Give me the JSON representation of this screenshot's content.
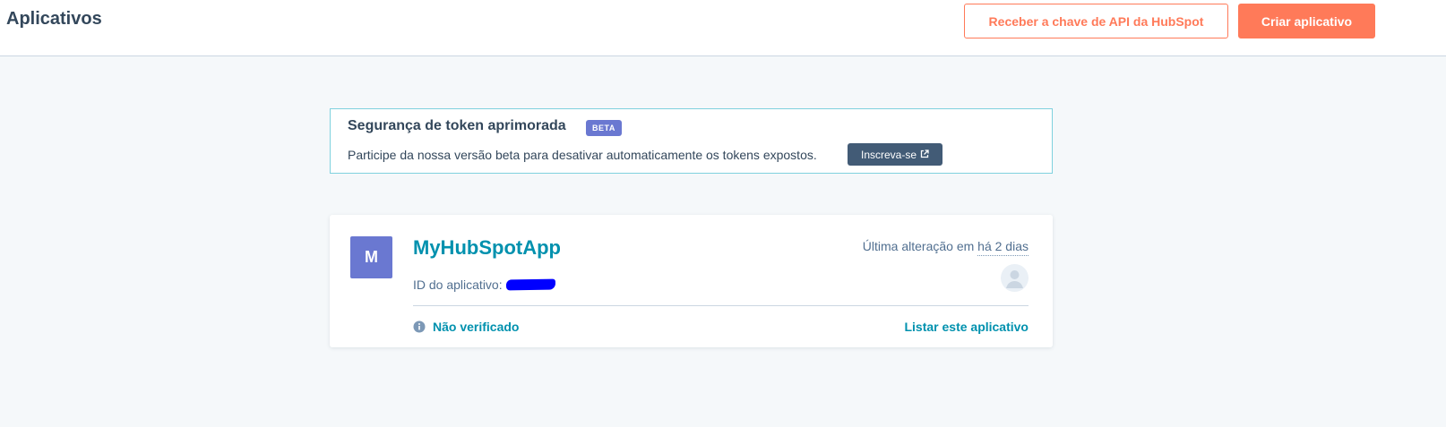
{
  "header": {
    "title": "Aplicativos",
    "api_key_button": "Receber a chave de API da HubSpot",
    "create_app_button": "Criar aplicativo"
  },
  "banner": {
    "title": "Segurança de token aprimorada",
    "badge": "BETA",
    "text": "Participe da nossa versão beta para desativar automaticamente os tokens expostos.",
    "button_label": "Inscreva-se",
    "button_icon": "external-link-icon"
  },
  "app_card": {
    "avatar_letter": "M",
    "name": "MyHubSpotApp",
    "id_label": "ID do aplicativo:",
    "last_modified_prefix": "Última alteração em",
    "last_modified_relative": "há 2 dias",
    "status": "Não verificado",
    "status_icon": "info-icon",
    "list_link": "Listar este aplicativo"
  },
  "colors": {
    "accent": "#ff7a59",
    "link": "#0091ae",
    "avatar": "#6a78d1",
    "dark_button": "#425b76",
    "redaction": "#0000ff"
  }
}
